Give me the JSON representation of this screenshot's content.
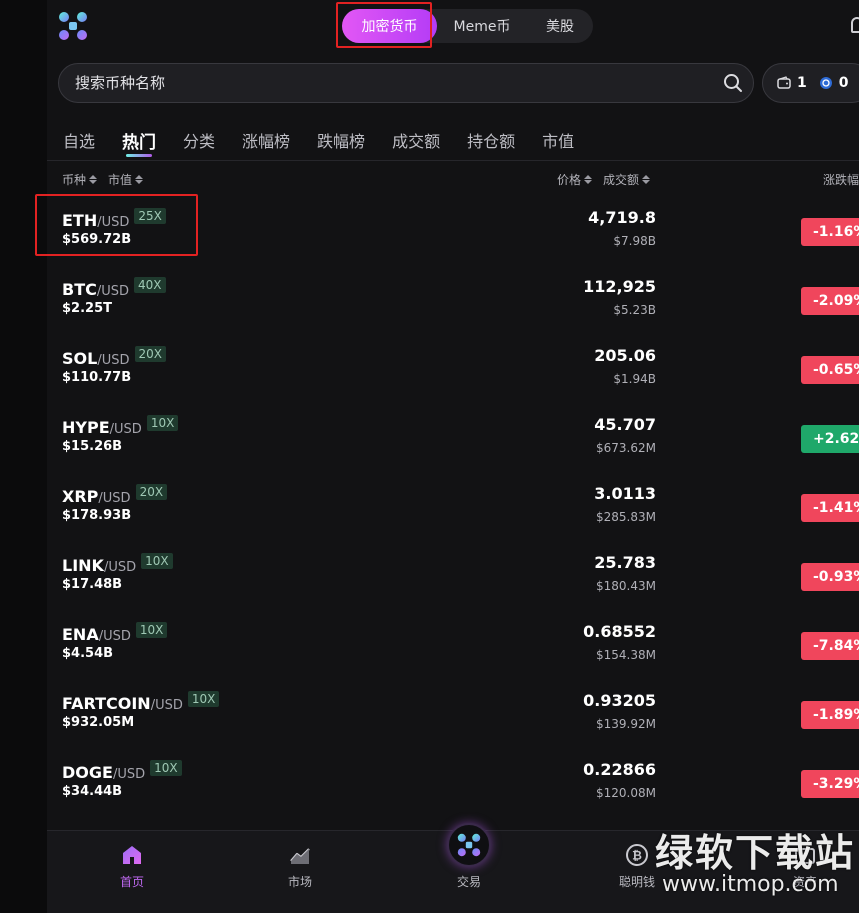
{
  "header": {
    "segments": [
      {
        "label": "加密货币",
        "active": true
      },
      {
        "label": "Meme币",
        "active": false
      },
      {
        "label": "美股",
        "active": false
      }
    ]
  },
  "search": {
    "placeholder": "搜索币种名称"
  },
  "wallet": {
    "wallet_count": "1",
    "coin_count": "0"
  },
  "tabs": [
    "自选",
    "热门",
    "分类",
    "涨幅榜",
    "跌幅榜",
    "成交额",
    "持仓额",
    "市值"
  ],
  "active_tab": "热门",
  "columns": {
    "coin": "币种",
    "mcap": "市值",
    "price": "价格",
    "volume": "成交额",
    "change": "涨跌幅"
  },
  "rows": [
    {
      "symbol": "ETH",
      "quote": "/USD",
      "leverage": "25X",
      "mcap": "$569.72B",
      "price": "4,719.8",
      "volume": "$7.98B",
      "change": "-1.16%",
      "direction": "down"
    },
    {
      "symbol": "BTC",
      "quote": "/USD",
      "leverage": "40X",
      "mcap": "$2.25T",
      "price": "112,925",
      "volume": "$5.23B",
      "change": "-2.09%",
      "direction": "down"
    },
    {
      "symbol": "SOL",
      "quote": "/USD",
      "leverage": "20X",
      "mcap": "$110.77B",
      "price": "205.06",
      "volume": "$1.94B",
      "change": "-0.65%",
      "direction": "down"
    },
    {
      "symbol": "HYPE",
      "quote": "/USD",
      "leverage": "10X",
      "mcap": "$15.26B",
      "price": "45.707",
      "volume": "$673.62M",
      "change": "+2.62%",
      "direction": "up"
    },
    {
      "symbol": "XRP",
      "quote": "/USD",
      "leverage": "20X",
      "mcap": "$178.93B",
      "price": "3.0113",
      "volume": "$285.83M",
      "change": "-1.41%",
      "direction": "down"
    },
    {
      "symbol": "LINK",
      "quote": "/USD",
      "leverage": "10X",
      "mcap": "$17.48B",
      "price": "25.783",
      "volume": "$180.43M",
      "change": "-0.93%",
      "direction": "down"
    },
    {
      "symbol": "ENA",
      "quote": "/USD",
      "leverage": "10X",
      "mcap": "$4.54B",
      "price": "0.68552",
      "volume": "$154.38M",
      "change": "-7.84%",
      "direction": "down"
    },
    {
      "symbol": "FARTCOIN",
      "quote": "/USD",
      "leverage": "10X",
      "mcap": "$932.05M",
      "price": "0.93205",
      "volume": "$139.92M",
      "change": "-1.89%",
      "direction": "down"
    },
    {
      "symbol": "DOGE",
      "quote": "/USD",
      "leverage": "10X",
      "mcap": "$34.44B",
      "price": "0.22866",
      "volume": "$120.08M",
      "change": "-3.29%",
      "direction": "down"
    }
  ],
  "bottom_nav": [
    {
      "label": "首页",
      "icon": "home-icon",
      "active": true
    },
    {
      "label": "市场",
      "icon": "market-chart-icon",
      "active": false
    },
    {
      "label": "交易",
      "icon": "trade-icon",
      "active": false
    },
    {
      "label": "聪明钱",
      "icon": "bitcoin-icon",
      "active": false
    },
    {
      "label": "资产",
      "icon": "assets-icon",
      "active": false
    }
  ],
  "watermark": {
    "title": "绿软下载站",
    "url": "www.itmop.com"
  },
  "colors": {
    "accent": "#c06af3",
    "down": "#f0465c",
    "up": "#1fa86a",
    "background": "#121214"
  }
}
